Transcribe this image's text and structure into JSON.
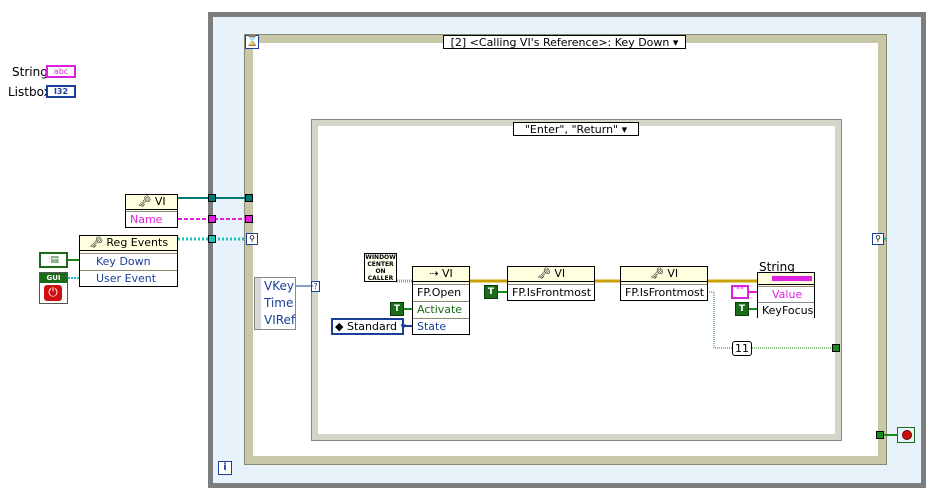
{
  "controls": {
    "string_label": "String",
    "listbox_label": "Listbox",
    "string_type": "abc",
    "listbox_type": "I32"
  },
  "left": {
    "vi_ref_title": "VI",
    "vi_ref_name": "Name",
    "reg_events_title": "Reg Events",
    "reg_events_key_down": "Key Down",
    "reg_events_user_event": "User Event",
    "gui_label": "GUI"
  },
  "event_structure": {
    "selector": "[2] <Calling VI's Reference>: Key Down",
    "event_data": [
      "VKey",
      "Time",
      "VIRef"
    ]
  },
  "case_structure": {
    "selector": "\"Enter\", \"Return\""
  },
  "nodes": {
    "window_const": [
      "WINDOW",
      "CENTER",
      "ON",
      "CALLER"
    ],
    "fp_open_title": "VI",
    "fp_open_method": "FP.Open",
    "fp_open_activate": "Activate",
    "fp_open_state": "State",
    "standard_enum": "Standard",
    "bool_true": "T",
    "prop1_title": "VI",
    "prop1_item": "FP.IsFrontmost",
    "prop2_title": "VI",
    "prop2_item": "FP.IsFrontmost",
    "string_ref_label": "String",
    "string_value": "Value",
    "string_keyfocus": "KeyFocus",
    "empty_string": "\"\"",
    "num_const": "11"
  },
  "colors": {
    "loop_border": "#7d7d7d",
    "frame_fill": "#e8f2fb",
    "structure_border": "#c8c8a8",
    "string_wire": "#e020e0",
    "ref_wire": "#007878",
    "bool_wire": "#1b8a1b",
    "event_wire": "#20c0c0"
  }
}
